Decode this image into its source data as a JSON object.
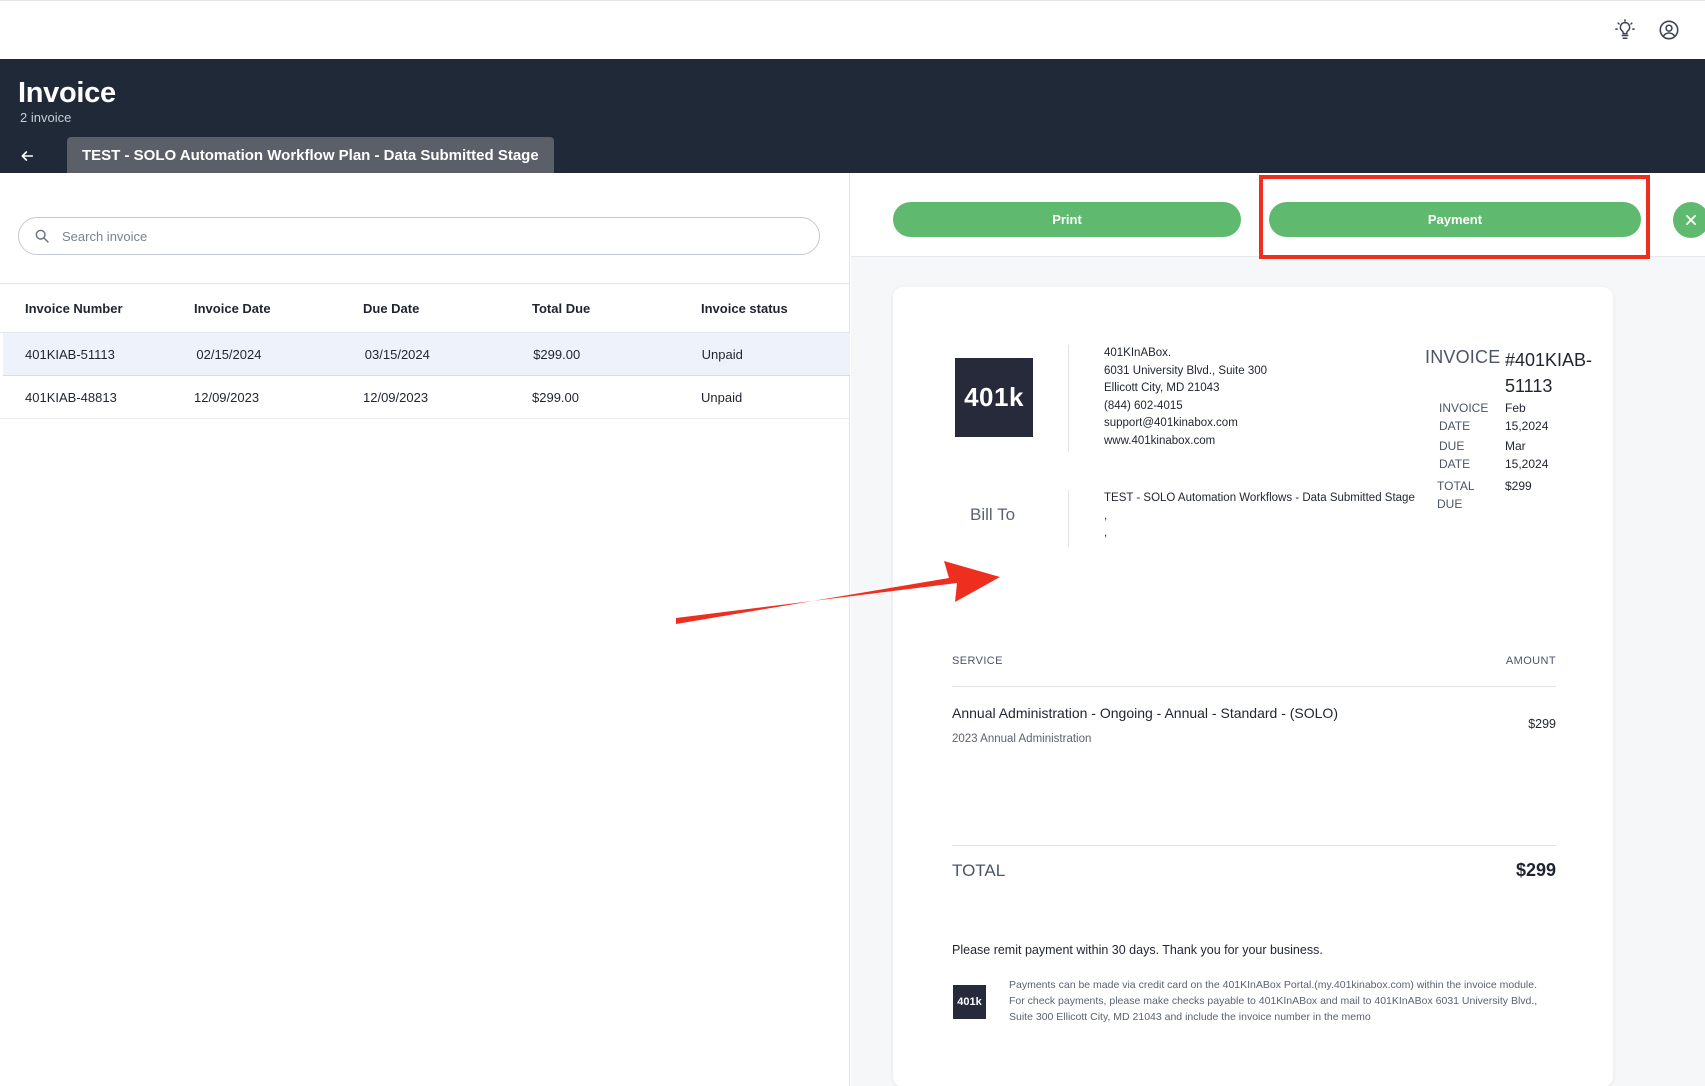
{
  "header": {
    "title": "Invoice",
    "subtitle": "2 invoice",
    "plan_tab": "TEST - SOLO Automation Workflow Plan - Data Submitted Stage"
  },
  "search": {
    "placeholder": "Search invoice",
    "value": ""
  },
  "table": {
    "columns": [
      "Invoice Number",
      "Invoice Date",
      "Due Date",
      "Total Due",
      "Invoice status"
    ],
    "rows": [
      [
        "401KIAB-51113",
        "02/15/2024",
        "03/15/2024",
        "$299.00",
        "Unpaid"
      ],
      [
        "401KIAB-48813",
        "12/09/2023",
        "12/09/2023",
        "$299.00",
        "Unpaid"
      ]
    ]
  },
  "actions": {
    "print_label": "Print",
    "payment_label": "Payment"
  },
  "invoice": {
    "logo_text": "401k",
    "company_lines": [
      "401KInABox.",
      "6031 University Blvd., Suite 300",
      "Ellicott City, MD 21043",
      "(844) 602-4015",
      "support@401kinabox.com",
      "www.401kinabox.com"
    ],
    "label": "INVOICE",
    "number": "#401KIAB-51113",
    "invoice_date_label": "INVOICE DATE",
    "invoice_date_value": "Feb 15,2024",
    "due_date_label": "DUE DATE",
    "due_date_value": "Mar 15,2024",
    "total_due_label": "TOTAL DUE",
    "total_due_value": "$299",
    "bill_to_label": "Bill To",
    "bill_to_lines": [
      "TEST - SOLO Automation Workflows - Data Submitted Stage",
      ",",
      ","
    ],
    "service_header": "SERVICE",
    "amount_header": "AMOUNT",
    "service_name": "Annual Administration - Ongoing - Annual - Standard - (SOLO)",
    "service_desc": "2023 Annual Administration",
    "service_amount": "$299",
    "total_label": "TOTAL",
    "total_value": "$299",
    "remit_text": "Please remit payment within 30 days. Thank you for your business.",
    "payment_note": "Payments can be made via credit card on the 401KInABox Portal.(my.401kinabox.com) within the invoice module. For check payments, please make checks payable to 401KInABox and mail to 401KInABox 6031 University Blvd., Suite 300 Ellicott City, MD 21043 and include the invoice number in the memo"
  },
  "colors": {
    "header_bg": "#1f2937",
    "tab_bg": "#5b6068",
    "button_green": "#5fba6f",
    "annotation_red": "#ee2e1f",
    "selected_row": "#eef2fb"
  },
  "icons": [
    "lightbulb-icon",
    "account-circle-icon",
    "back-arrow-icon",
    "search-icon",
    "close-icon"
  ]
}
